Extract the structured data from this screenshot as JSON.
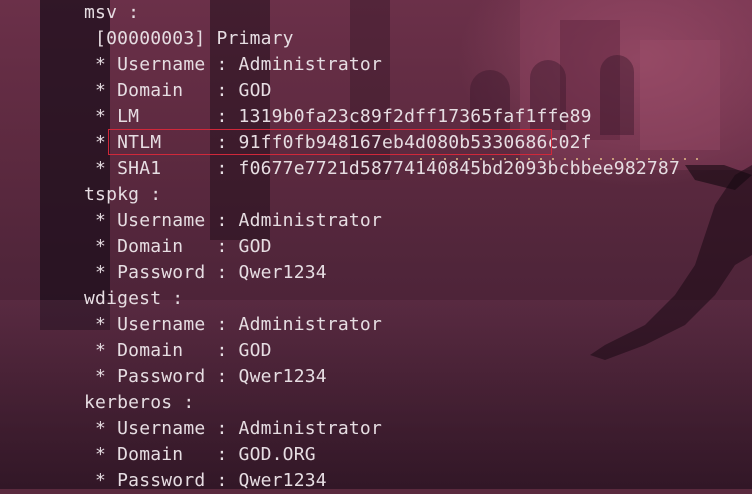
{
  "terminal": {
    "lines": [
      {
        "indent": "",
        "text": "msv :"
      },
      {
        "indent": " ",
        "text": "[00000003] Primary"
      },
      {
        "indent": " ",
        "text": "* Username : Administrator"
      },
      {
        "indent": " ",
        "text": "* Domain   : GOD"
      },
      {
        "indent": " ",
        "text": "* LM       : 1319b0fa23c89f2dff17365faf1ffe89"
      },
      {
        "indent": " ",
        "text": "* NTLM     : 91ff0fb948167eb4d080b5330686c02f"
      },
      {
        "indent": " ",
        "text": "* SHA1     : f0677e7721d58774140845bd2093bcbbee982787"
      },
      {
        "indent": "",
        "text": "tspkg :"
      },
      {
        "indent": " ",
        "text": "* Username : Administrator"
      },
      {
        "indent": " ",
        "text": "* Domain   : GOD"
      },
      {
        "indent": " ",
        "text": "* Password : Qwer1234"
      },
      {
        "indent": "",
        "text": "wdigest :"
      },
      {
        "indent": " ",
        "text": "* Username : Administrator"
      },
      {
        "indent": " ",
        "text": "* Domain   : GOD"
      },
      {
        "indent": " ",
        "text": "* Password : Qwer1234"
      },
      {
        "indent": "",
        "text": "kerberos :"
      },
      {
        "indent": " ",
        "text": "* Username : Administrator"
      },
      {
        "indent": " ",
        "text": "* Domain   : GOD.ORG"
      },
      {
        "indent": " ",
        "text": "* Password : Qwer1234"
      }
    ],
    "highlighted_line_index": 5
  },
  "colors": {
    "text": "#e6dde2",
    "highlight_border": "#d0283a",
    "background": "#5a2a3e"
  }
}
